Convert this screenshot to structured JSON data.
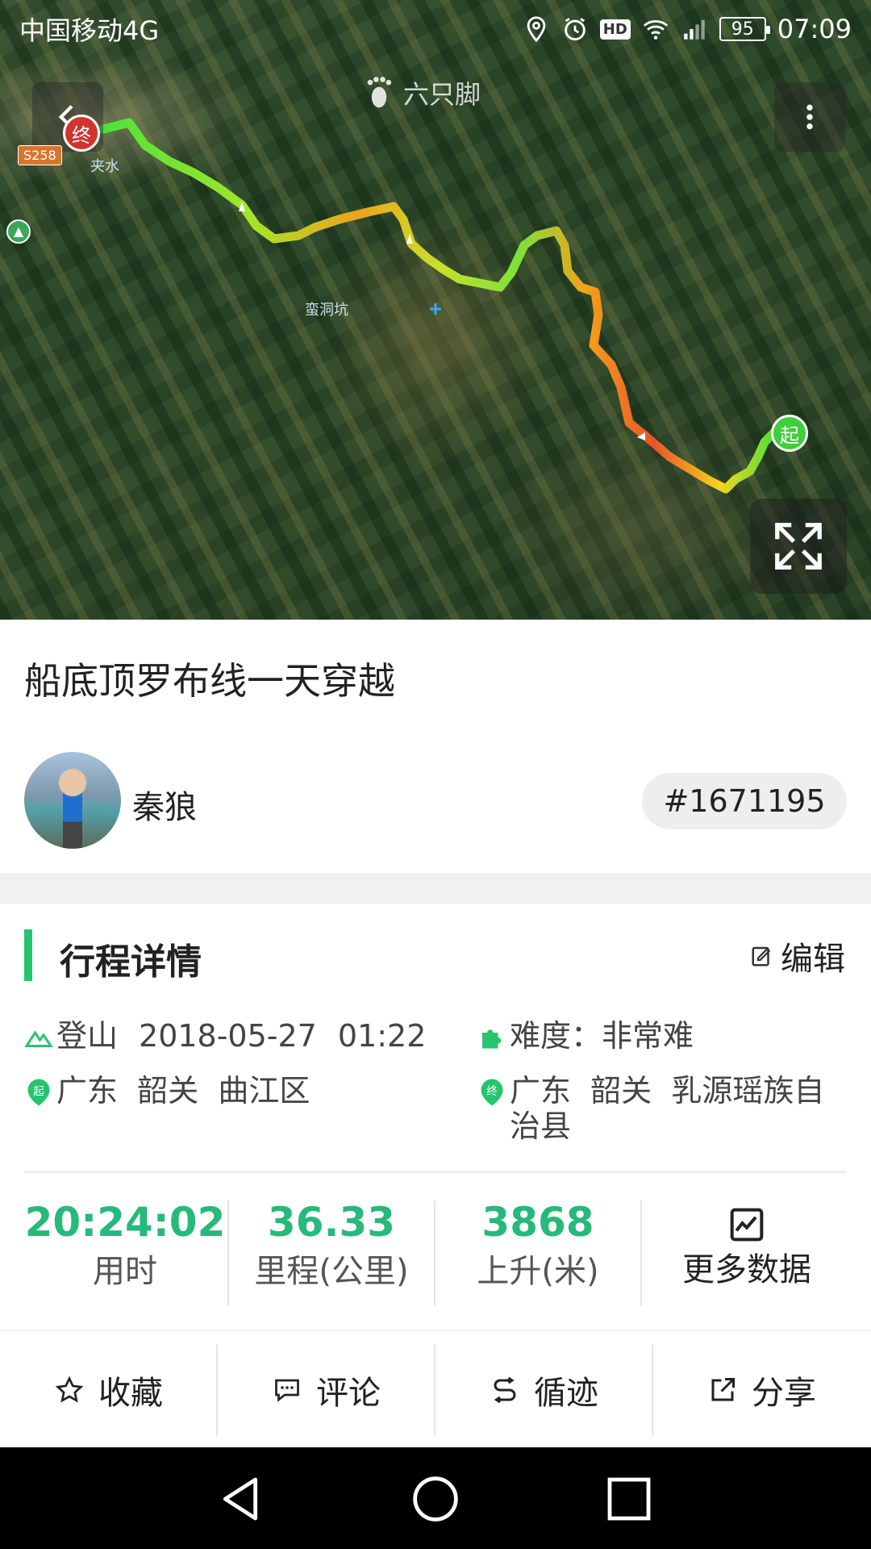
{
  "status_bar": {
    "carrier": "中国移动4G",
    "network_badge": "4G",
    "hd_badge": "HD",
    "battery": "95",
    "time": "07:09",
    "icons": [
      "location-icon",
      "alarm-icon",
      "hd-icon",
      "wifi-icon",
      "signal-icon",
      "battery-icon"
    ]
  },
  "map": {
    "logo_text": "六只脚",
    "place_label": "蛮洞坑",
    "town_label": "夹水",
    "road_badge": "S258",
    "start_marker": "起",
    "end_marker": "终",
    "route_colors": [
      "#5fd635",
      "#b6e52a",
      "#f0c21a",
      "#f28b1c",
      "#e8462a"
    ]
  },
  "trip": {
    "title": "船底顶罗布线一天穿越",
    "username": "秦狼",
    "trip_id": "#1671195"
  },
  "details": {
    "section_title": "行程详情",
    "edit_label": "编辑",
    "activity": "登山",
    "date": "2018-05-27",
    "time": "01:22",
    "difficulty": "难度：非常难",
    "start_badge": "起",
    "end_badge": "终",
    "start_location": "广东  韶关  曲江区",
    "end_location": "广东  韶关  乳源瑶族自治县",
    "accent_color": "#27c46e"
  },
  "stats": [
    {
      "value": "20:24:02",
      "label": "用时"
    },
    {
      "value": "36.33",
      "label": "里程(公里)"
    },
    {
      "value": "3868",
      "label": "上升(米)"
    }
  ],
  "more_data_label": "更多数据",
  "actions": [
    {
      "label": "收藏",
      "icon": "star-icon"
    },
    {
      "label": "评论",
      "icon": "comment-icon"
    },
    {
      "label": "循迹",
      "icon": "track-icon"
    },
    {
      "label": "分享",
      "icon": "share-icon"
    }
  ],
  "nav": [
    "back-triangle-icon",
    "home-circle-icon",
    "recents-square-icon"
  ]
}
